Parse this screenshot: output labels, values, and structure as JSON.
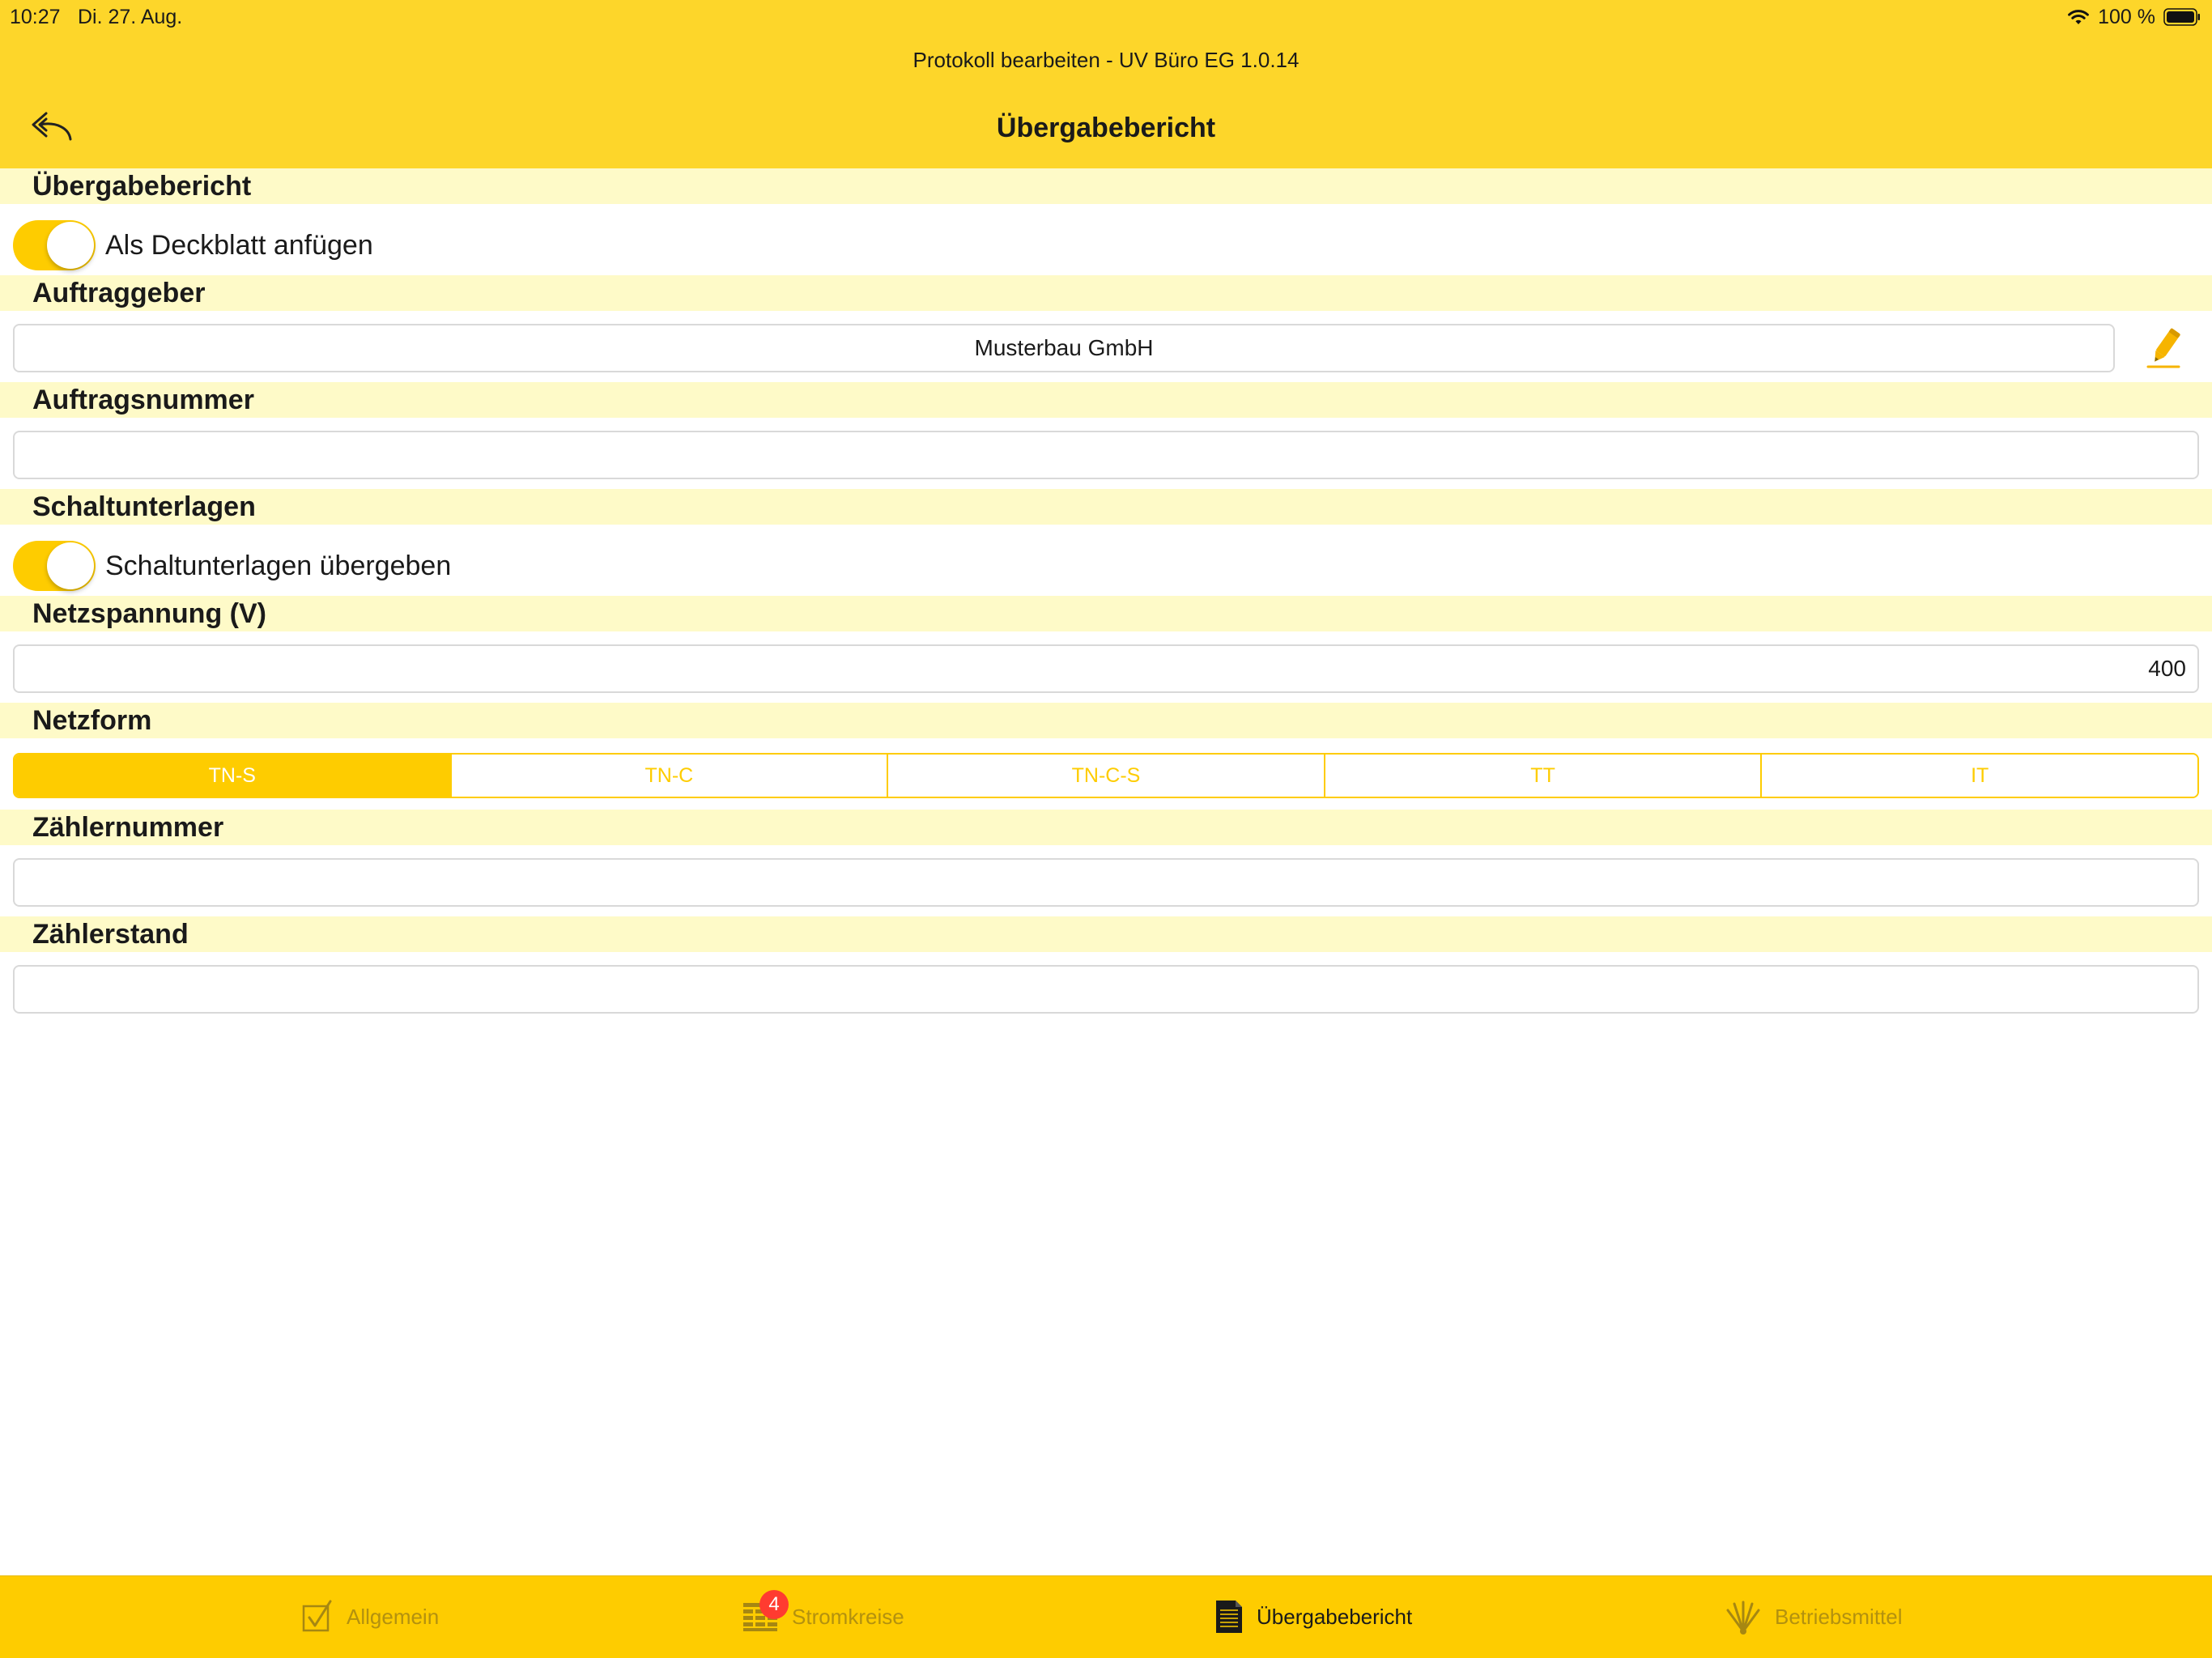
{
  "status_bar": {
    "time": "10:27",
    "date": "Di. 27. Aug.",
    "battery": "100 %"
  },
  "window_title": "Protokoll bearbeiten - UV Büro EG 1.0.14",
  "nav": {
    "title": "Übergabebericht",
    "back_icon": "reply-arrow-icon"
  },
  "sections": {
    "uebergabebericht": {
      "title": "Übergabebericht",
      "toggle_label": "Als Deckblatt anfügen",
      "toggle_on": true
    },
    "auftraggeber": {
      "title": "Auftraggeber",
      "value": "Musterbau GmbH",
      "edit_icon": "pencil-icon"
    },
    "auftragsnummer": {
      "title": "Auftragsnummer",
      "value": ""
    },
    "schaltunterlagen": {
      "title": "Schaltunterlagen",
      "toggle_label": "Schaltunterlagen übergeben",
      "toggle_on": true
    },
    "netzspannung": {
      "title": "Netzspannung (V)",
      "value": "400"
    },
    "netzform": {
      "title": "Netzform",
      "options": [
        "TN-S",
        "TN-C",
        "TN-C-S",
        "TT",
        "IT"
      ],
      "selected": "TN-S"
    },
    "zaehlernummer": {
      "title": "Zählernummer",
      "value": ""
    },
    "zaehlerstand": {
      "title": "Zählerstand",
      "value": ""
    }
  },
  "tabs": [
    {
      "label": "Allgemein",
      "icon": "checkbox-icon",
      "active": false
    },
    {
      "label": "Stromkreise",
      "icon": "grid-icon",
      "active": false,
      "badge": "4"
    },
    {
      "label": "Übergabebericht",
      "icon": "document-icon",
      "active": true
    },
    {
      "label": "Betriebsmittel",
      "icon": "tools-icon",
      "active": false
    }
  ],
  "colors": {
    "bar_yellow": "#fdd62a",
    "accent_yellow": "#fecc00",
    "section_bg": "#fefac8",
    "badge_red": "#ff3b30"
  }
}
